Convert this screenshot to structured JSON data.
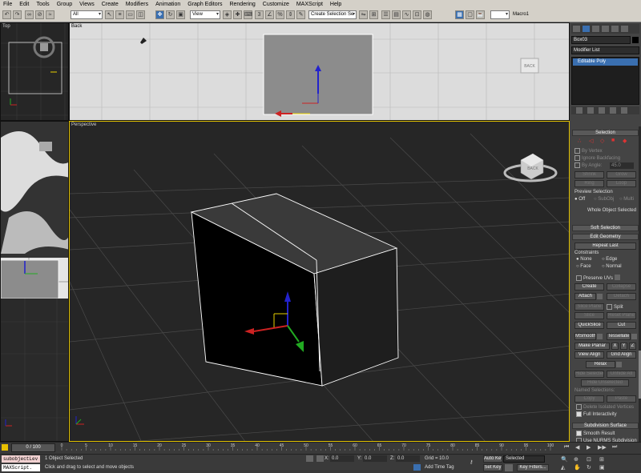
{
  "menu": [
    "File",
    "Edit",
    "Tools",
    "Group",
    "Views",
    "Create",
    "Modifiers",
    "Animation",
    "Graph Editors",
    "Rendering",
    "Customize",
    "MAXScript",
    "Help"
  ],
  "toolbar": {
    "filter": "All",
    "ref_coord": "View",
    "named_selection": "Create Selection Se",
    "macro": "Macro1"
  },
  "viewports": {
    "top": "Top",
    "back": "Back",
    "perspective": "Perspective"
  },
  "viewcube": {
    "back_label": "BACK"
  },
  "command_panel": {
    "object_name": "Box03",
    "modifier_list": "Modifier List",
    "stack_item": "Editable Poly",
    "selection": {
      "title": "Selection",
      "by_vertex": "By Vertex",
      "ignore_backfacing": "Ignore Backfacing",
      "by_angle": "By Angle:",
      "angle_value": "45.0",
      "shrink": "Shrink",
      "grow": "Grow",
      "ring": "Ring",
      "loop": "Loop",
      "preview_selection": "Preview Selection",
      "off": "Off",
      "subobj": "SubObj",
      "multi": "Multi",
      "status": "Whole Object Selected"
    },
    "soft_selection": {
      "title": "Soft Selection"
    },
    "edit_geometry": {
      "title": "Edit Geometry",
      "repeat_last": "Repeat Last",
      "constraints": "Constraints",
      "none": "None",
      "edge": "Edge",
      "face": "Face",
      "normal": "Normal",
      "preserve_uvs": "Preserve UVs",
      "create": "Create",
      "collapse": "Collapse",
      "attach": "Attach",
      "detach": "Detach",
      "slice_plane": "Slice Plane",
      "split": "Split",
      "slice": "Slice",
      "reset_plane": "Reset Plane",
      "quickslice": "QuickSlice",
      "cut": "Cut",
      "msmooth": "MSmooth",
      "tessellate": "Tessellate",
      "make_planar": "Make Planar",
      "x": "X",
      "y": "Y",
      "z": "Z",
      "view_align": "View Align",
      "grid_align": "Grid Align",
      "relax": "Relax",
      "hide_selected": "Hide Selected",
      "unhide_all": "Unhide All",
      "hide_unselected": "Hide Unselected",
      "named_selections": "Named Selections:",
      "copy": "Copy",
      "paste": "Paste",
      "delete_isolated": "Delete Isolated Vertices",
      "full_interactivity": "Full Interactivity"
    },
    "subdivision_surface": {
      "title": "Subdivision Surface",
      "smooth_result": "Smooth Result",
      "use_nurms": "Use NURMS Subdivision"
    }
  },
  "timeline": {
    "frame_display": "0 / 100",
    "ticks": [
      "0",
      "5",
      "10",
      "15",
      "20",
      "25",
      "30",
      "35",
      "40",
      "45",
      "50",
      "55",
      "60",
      "65",
      "70",
      "75",
      "80",
      "85",
      "90",
      "95",
      "100"
    ]
  },
  "status": {
    "listener_1": "subobjectLev",
    "listener_2": "MAXScript.",
    "objects_selected": "1 Object Selected",
    "prompt": "Click and drag to select and move objects",
    "x_label": "X:",
    "x_value": "0.0",
    "y_label": "Y:",
    "y_value": "0.0",
    "z_label": "Z:",
    "z_value": "0.0",
    "grid": "Grid = 10.0",
    "add_time_tag": "Add Time Tag",
    "auto_key": "Auto Key",
    "selected": "Selected",
    "set_key": "Set Key",
    "key_filters": "Key Filters..."
  },
  "colors": {
    "panel_bg": "#444444",
    "viewport_bg": "#262626",
    "accent": "#3a6fb0",
    "light_viewport": "#d8d8d8"
  }
}
